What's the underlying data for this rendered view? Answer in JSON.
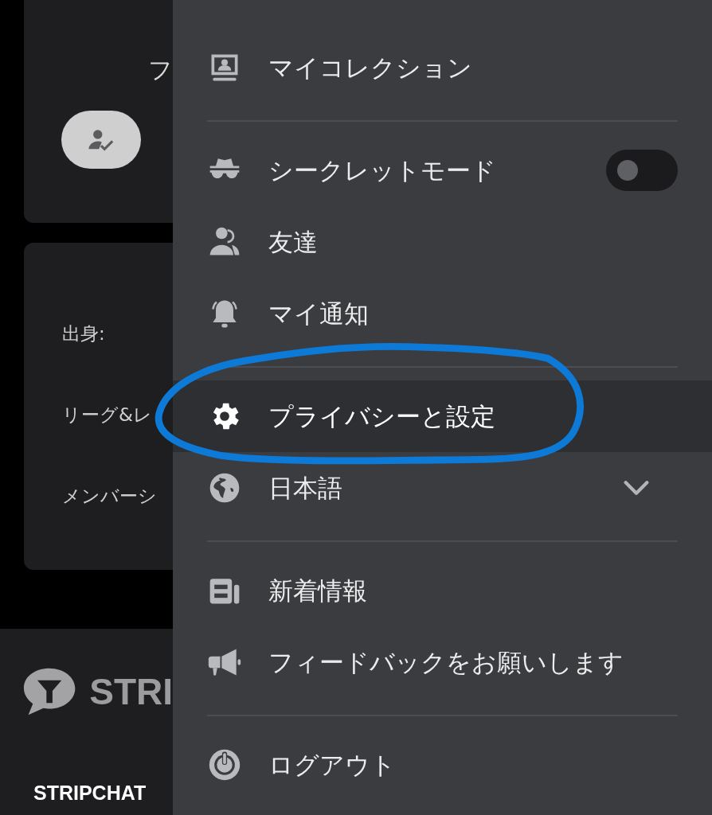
{
  "profile_card": {
    "heading_fragment": "フ",
    "verify_button": {
      "disabled": false
    }
  },
  "details_card": {
    "labels": [
      "出身:",
      "リーグ&レ",
      "メンバーシ"
    ]
  },
  "footer": {
    "logo_text": "STRI",
    "brand_label": "STRIPCHAT"
  },
  "menu": {
    "sections": [
      {
        "items": [
          {
            "kind": "link",
            "label": "マイコレクション",
            "selected": false
          }
        ]
      },
      {
        "items": [
          {
            "kind": "toggle",
            "label": "シークレットモード",
            "on": false,
            "selected": false
          },
          {
            "kind": "link",
            "label": "友達",
            "selected": false
          },
          {
            "kind": "link",
            "label": "マイ通知",
            "selected": false
          }
        ]
      },
      {
        "items": [
          {
            "kind": "link",
            "label": "プライバシーと設定",
            "selected": true
          },
          {
            "kind": "dropdown",
            "label": "日本語",
            "expanded": false,
            "selected": false
          }
        ]
      },
      {
        "items": [
          {
            "kind": "link",
            "label": "新着情報",
            "selected": false
          },
          {
            "kind": "link",
            "label": "フィードバックをお願いします",
            "selected": false
          }
        ]
      },
      {
        "items": [
          {
            "kind": "link",
            "label": "ログアウト",
            "selected": false
          }
        ]
      }
    ]
  },
  "annotation": {
    "kind": "ellipse"
  }
}
